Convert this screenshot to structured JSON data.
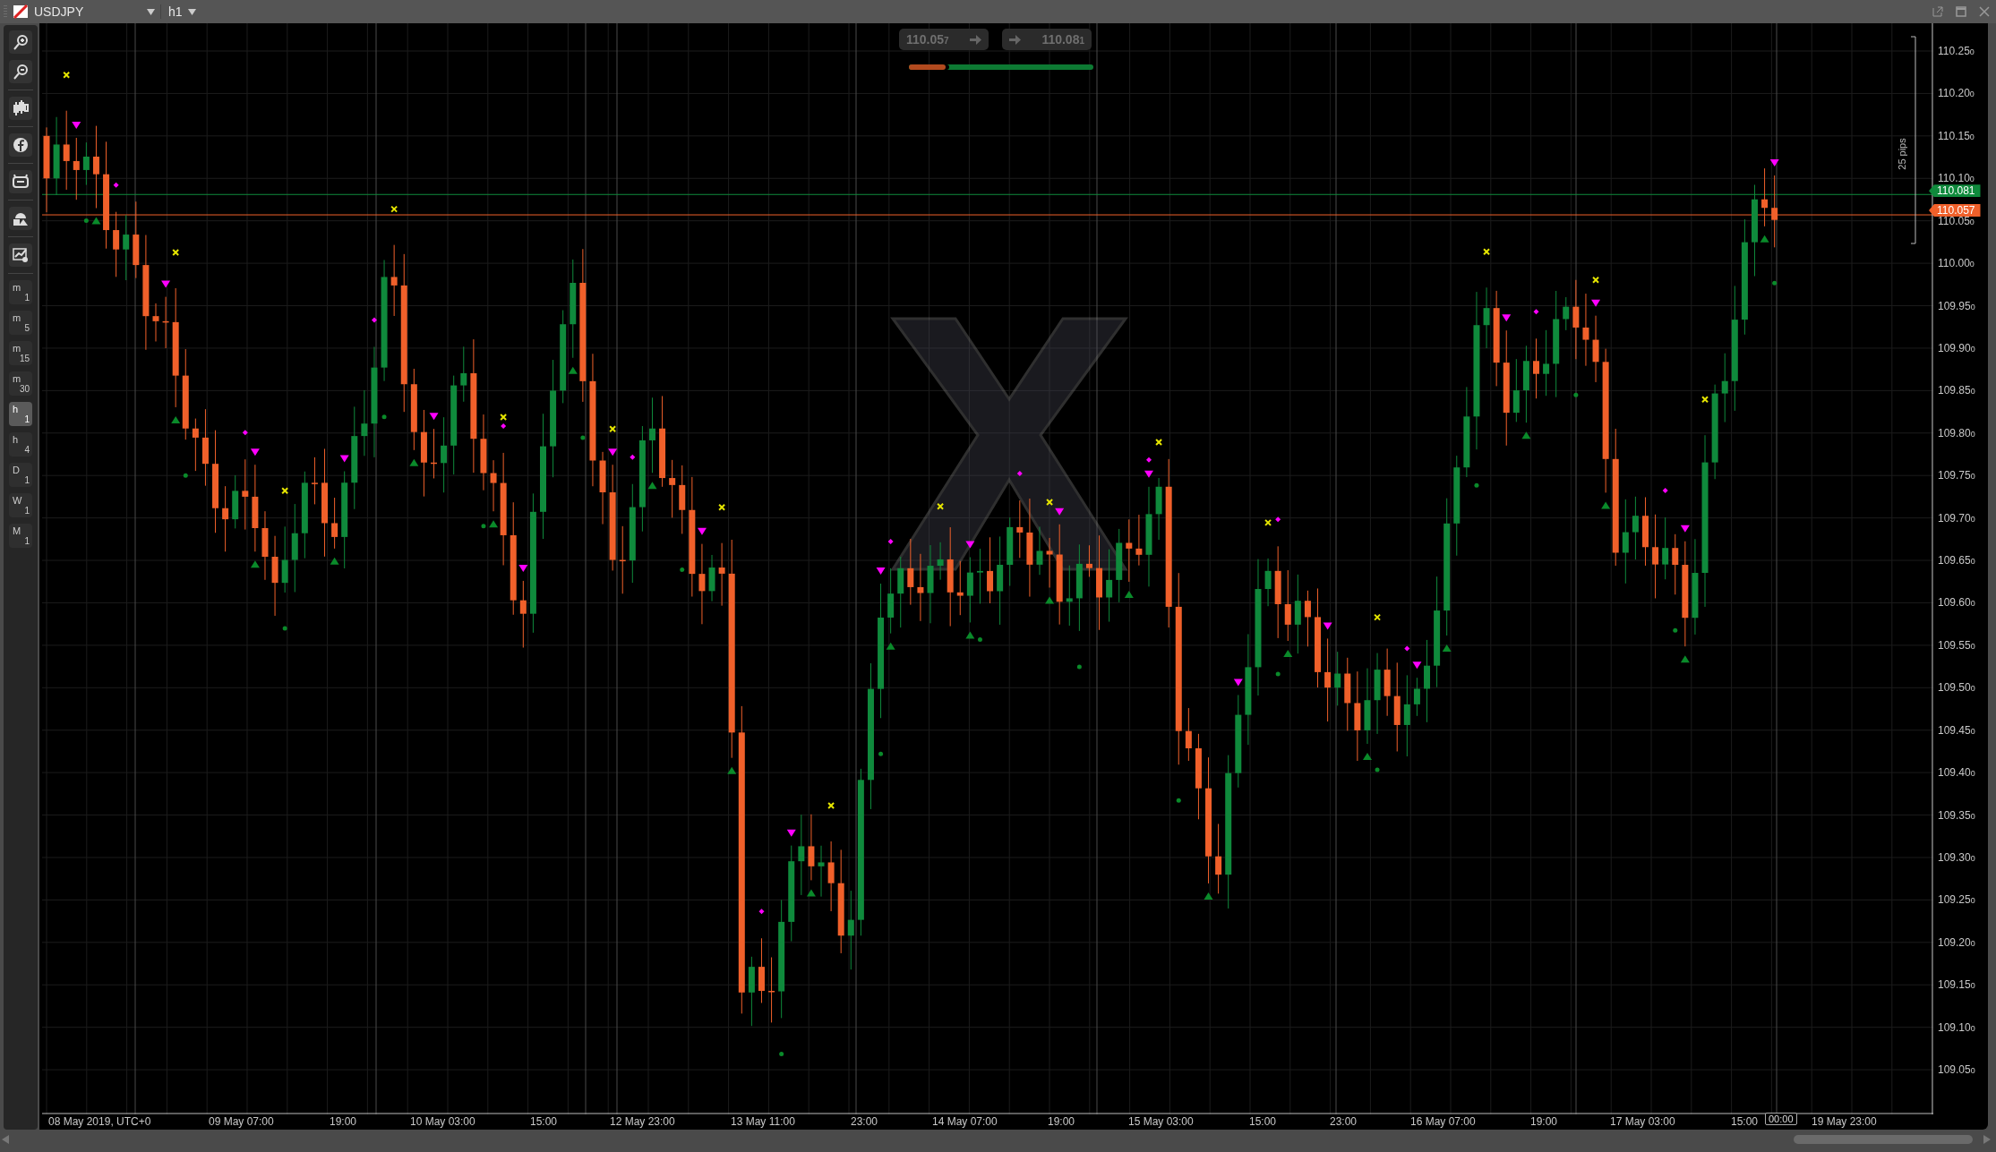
{
  "top_bar": {
    "symbol": "USDJPY",
    "timeframe": "h1"
  },
  "timeframes": [
    {
      "letter": "m",
      "number": "1",
      "selected": false
    },
    {
      "letter": "m",
      "number": "5",
      "selected": false
    },
    {
      "letter": "m",
      "number": "15",
      "selected": false
    },
    {
      "letter": "m",
      "number": "30",
      "selected": false
    },
    {
      "letter": "h",
      "number": "1",
      "selected": true
    },
    {
      "letter": "h",
      "number": "4",
      "selected": false
    },
    {
      "letter": "D",
      "number": "1",
      "selected": false
    },
    {
      "letter": "W",
      "number": "1",
      "selected": false
    },
    {
      "letter": "M",
      "number": "1",
      "selected": false
    }
  ],
  "quote": {
    "sell": {
      "price": "110.05",
      "pipette": "7"
    },
    "buy": {
      "price": "110.08",
      "pipette": "1"
    },
    "level": 0.2
  },
  "price_axis": {
    "ticks": [
      {
        "price": "110.25",
        "pipette": "0"
      },
      {
        "price": "110.20",
        "pipette": "0"
      },
      {
        "price": "110.15",
        "pipette": "0"
      },
      {
        "price": "110.10",
        "pipette": "0"
      },
      {
        "price": "110.05",
        "pipette": "0"
      },
      {
        "price": "110.00",
        "pipette": "0"
      },
      {
        "price": "109.95",
        "pipette": "0"
      },
      {
        "price": "109.90",
        "pipette": "0"
      },
      {
        "price": "109.85",
        "pipette": "0"
      },
      {
        "price": "109.80",
        "pipette": "0"
      },
      {
        "price": "109.75",
        "pipette": "0"
      },
      {
        "price": "109.70",
        "pipette": "0"
      },
      {
        "price": "109.65",
        "pipette": "0"
      },
      {
        "price": "109.60",
        "pipette": "0"
      },
      {
        "price": "109.55",
        "pipette": "0"
      },
      {
        "price": "109.50",
        "pipette": "0"
      },
      {
        "price": "109.45",
        "pipette": "0"
      },
      {
        "price": "109.40",
        "pipette": "0"
      },
      {
        "price": "109.35",
        "pipette": "0"
      },
      {
        "price": "109.30",
        "pipette": "0"
      },
      {
        "price": "109.25",
        "pipette": "0"
      },
      {
        "price": "109.20",
        "pipette": "0"
      },
      {
        "price": "109.15",
        "pipette": "0"
      },
      {
        "price": "109.10",
        "pipette": "0"
      },
      {
        "price": "109.05",
        "pipette": "0"
      }
    ],
    "pips_label": "25 pips",
    "ask_label": "110.081",
    "bid_label": "110.057"
  },
  "time_axis": {
    "labels": [
      "08 May 2019, UTC+0",
      "09 May 07:00",
      "19:00",
      "10 May 03:00",
      "15:00",
      "12 May 23:00",
      "13 May 11:00",
      "23:00",
      "14 May 07:00",
      "19:00",
      "15 May 03:00",
      "15:00",
      "23:00",
      "16 May 07:00",
      "19:00",
      "17 May 03:00",
      "15:00",
      "19 May 23:00"
    ],
    "cursor_label": "00:00"
  }
}
